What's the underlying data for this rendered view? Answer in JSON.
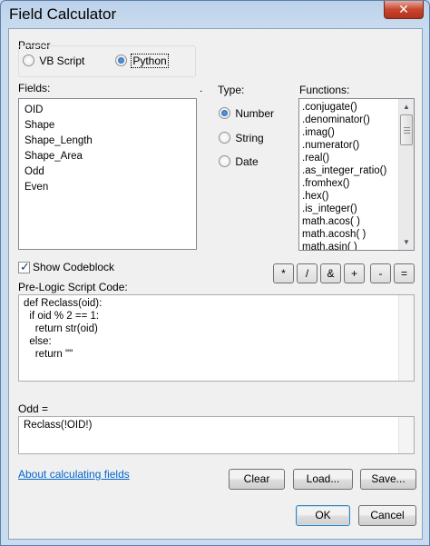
{
  "window": {
    "title": "Field Calculator",
    "close_glyph": "✕"
  },
  "parser": {
    "label": "Parser",
    "options": [
      {
        "label": "VB Script",
        "selected": false
      },
      {
        "label": "Python",
        "selected": true
      }
    ]
  },
  "fields": {
    "label": "Fields:",
    "items": [
      "OID",
      "Shape",
      "Shape_Length",
      "Shape_Area",
      "Odd",
      "Even"
    ]
  },
  "type": {
    "label": "Type:",
    "options": [
      {
        "label": "Number",
        "selected": true
      },
      {
        "label": "String",
        "selected": false
      },
      {
        "label": "Date",
        "selected": false
      }
    ]
  },
  "functions": {
    "label": "Functions:",
    "items": [
      ".conjugate()",
      ".denominator()",
      ".imag()",
      ".numerator()",
      ".real()",
      ".as_integer_ratio()",
      ".fromhex()",
      ".hex()",
      ".is_integer()",
      "math.acos( )",
      "math.acosh( )",
      "math.asin( )"
    ]
  },
  "show_codeblock": {
    "label": "Show Codeblock",
    "checked": true
  },
  "operators": [
    "*",
    "/",
    "&",
    "+",
    "-",
    "="
  ],
  "pre_logic": {
    "label": "Pre-Logic Script Code:",
    "lines": [
      "def Reclass(oid):",
      "  if oid % 2 == 1:",
      "    return str(oid)",
      "  else:",
      "    return \"\""
    ]
  },
  "expression": {
    "label": "Odd =",
    "value": "Reclass(!OID!)"
  },
  "help_link": "About calculating fields",
  "buttons": {
    "clear": "Clear",
    "load": "Load...",
    "save": "Save...",
    "ok": "OK",
    "cancel": "Cancel"
  },
  "icons": {
    "scroll_up": "▲",
    "scroll_down": "▼",
    "check": "✓",
    "sort_marker": "˙"
  }
}
